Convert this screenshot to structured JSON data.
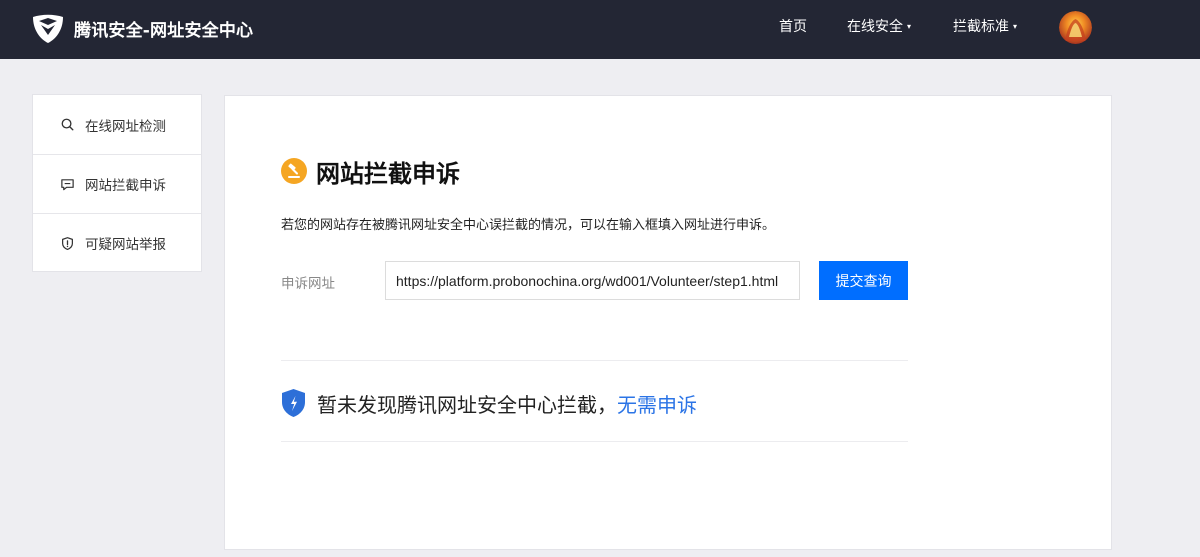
{
  "header": {
    "brand_title": "腾讯安全-网址安全中心",
    "logo_icon": "tencent-security-shield-logo",
    "nav": [
      {
        "label": "首页",
        "has_dropdown": false
      },
      {
        "label": "在线安全",
        "has_dropdown": true
      },
      {
        "label": "拦截标准",
        "has_dropdown": true
      }
    ],
    "caret": "▾",
    "avatar_icon": "user-avatar"
  },
  "sidebar": {
    "items": [
      {
        "label": "在线网址检测",
        "icon": "search-icon"
      },
      {
        "label": "网站拦截申诉",
        "icon": "chat-icon"
      },
      {
        "label": "可疑网站举报",
        "icon": "warning-shield-icon"
      }
    ]
  },
  "main": {
    "title": "网站拦截申诉",
    "title_icon": "gavel-icon",
    "description": "若您的网站存在被腾讯网址安全中心误拦截的情况，可以在输入框填入网址进行申诉。",
    "field_label": "申诉网址",
    "url_value": "https://platform.probonochina.org/wd001/Volunteer/step1.html",
    "submit_label": "提交查询",
    "result_text": "暂未发现腾讯网址安全中心拦截，",
    "result_link": "无需申诉",
    "result_icon": "shield-check-icon"
  },
  "colors": {
    "navbar_bg": "#232634",
    "page_bg": "#eeeef2",
    "primary_button": "#006eff",
    "link_blue": "#2b74e6",
    "title_icon_orange": "#f5a623",
    "shield_blue": "#2d6fd8"
  }
}
